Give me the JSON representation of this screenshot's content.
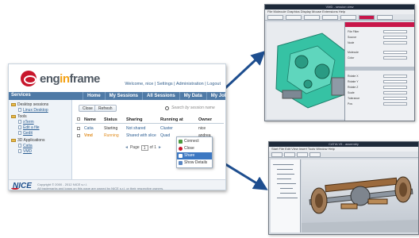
{
  "portal": {
    "logo_text_pre": "eng",
    "logo_text_accent": "in",
    "logo_text_post": "frame",
    "welcome": "Welcome, nice | Settings | Administration | Logout",
    "services_label": "Services",
    "tabs": [
      "Home",
      "My Sessions",
      "All Sessions",
      "My Data",
      "My Jobs"
    ],
    "sidebar": {
      "groups": [
        {
          "label": "Desktop sessions",
          "items": [
            "Linux Desktop"
          ]
        },
        {
          "label": "Tools",
          "items": [
            "xTerm",
            "Edit a file",
            "Gedit"
          ]
        },
        {
          "label": "3D Applications",
          "items": [
            "Catia",
            "VMD"
          ]
        }
      ]
    },
    "toolbar": {
      "close_label": "Close",
      "refresh_label": "Refresh",
      "search_placeholder": "Search by session name"
    },
    "table": {
      "headers": [
        "Name",
        "Status",
        "Sharing",
        "Running at",
        "Owner"
      ],
      "rows": [
        {
          "name": "Catia",
          "status": "Starting",
          "sharing": "Not shared",
          "running_at": "Cluster",
          "owner": "nice"
        },
        {
          "name": "Vmd",
          "status": "Running",
          "sharing": "Shared with slice",
          "running_at": "Quad",
          "owner": "andrea"
        }
      ],
      "pager": {
        "prev": "◄",
        "page_label": "Page",
        "page_value": "1",
        "of_label": "of 1",
        "next": "►"
      }
    },
    "context_menu": [
      "Connect",
      "Close",
      "Share",
      "Show Details"
    ],
    "footer": {
      "brand": "NICE",
      "copyright_line1": "Copyright © 2000 - 2012 NICE s.r.l.",
      "copyright_line2": "All trademarks and logos on this page are owned by NICE s.r.l. or their respective owners."
    }
  },
  "screenshots": {
    "shot1": {
      "title": "VMD - session view",
      "menu": "File  Molecule  Graphics  Display  Mouse  Extensions  Help",
      "properties": [
        "File Filter",
        "Source",
        "Node",
        "Molecule",
        "Color",
        "Rotate X",
        "Rotate Y",
        "Rotate Z",
        "Scale",
        "Tolerance",
        "Pos"
      ]
    },
    "shot2": {
      "title": "CATIA V5 - assembly",
      "menu": "Start  File  Edit  View  Insert  Tools  Window  Help"
    }
  },
  "colors": {
    "brand_red": "#c8162b",
    "brand_orange": "#f3a012",
    "nav_blue": "#4f7aa6",
    "arrow_blue": "#1e4e8f",
    "part_green": "#36c2a4",
    "part_copper": "#9b6a3d"
  }
}
